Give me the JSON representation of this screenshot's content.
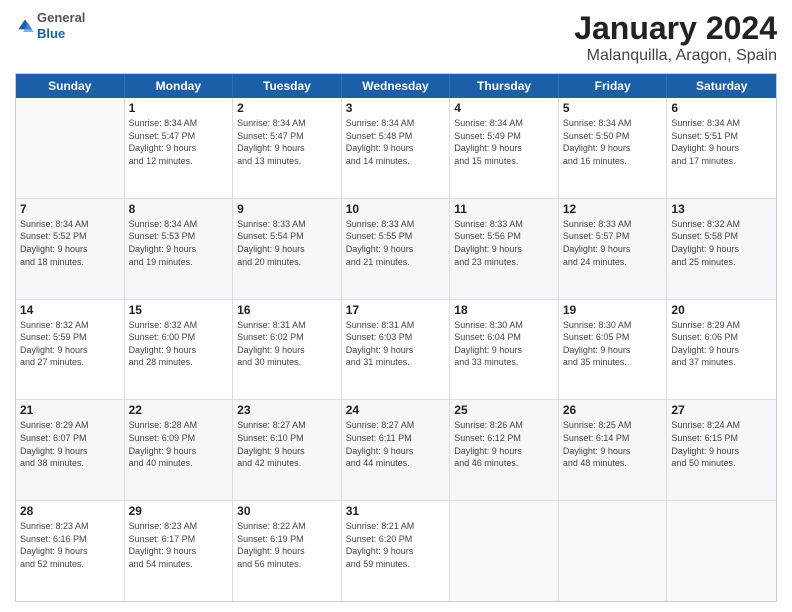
{
  "logo": {
    "general": "General",
    "blue": "Blue"
  },
  "title": "January 2024",
  "subtitle": "Malanquilla, Aragon, Spain",
  "days_header": [
    "Sunday",
    "Monday",
    "Tuesday",
    "Wednesday",
    "Thursday",
    "Friday",
    "Saturday"
  ],
  "weeks": [
    [
      {
        "day": "",
        "info": ""
      },
      {
        "day": "1",
        "info": "Sunrise: 8:34 AM\nSunset: 5:47 PM\nDaylight: 9 hours\nand 12 minutes."
      },
      {
        "day": "2",
        "info": "Sunrise: 8:34 AM\nSunset: 5:47 PM\nDaylight: 9 hours\nand 13 minutes."
      },
      {
        "day": "3",
        "info": "Sunrise: 8:34 AM\nSunset: 5:48 PM\nDaylight: 9 hours\nand 14 minutes."
      },
      {
        "day": "4",
        "info": "Sunrise: 8:34 AM\nSunset: 5:49 PM\nDaylight: 9 hours\nand 15 minutes."
      },
      {
        "day": "5",
        "info": "Sunrise: 8:34 AM\nSunset: 5:50 PM\nDaylight: 9 hours\nand 16 minutes."
      },
      {
        "day": "6",
        "info": "Sunrise: 8:34 AM\nSunset: 5:51 PM\nDaylight: 9 hours\nand 17 minutes."
      }
    ],
    [
      {
        "day": "7",
        "info": "Sunrise: 8:34 AM\nSunset: 5:52 PM\nDaylight: 9 hours\nand 18 minutes."
      },
      {
        "day": "8",
        "info": "Sunrise: 8:34 AM\nSunset: 5:53 PM\nDaylight: 9 hours\nand 19 minutes."
      },
      {
        "day": "9",
        "info": "Sunrise: 8:33 AM\nSunset: 5:54 PM\nDaylight: 9 hours\nand 20 minutes."
      },
      {
        "day": "10",
        "info": "Sunrise: 8:33 AM\nSunset: 5:55 PM\nDaylight: 9 hours\nand 21 minutes."
      },
      {
        "day": "11",
        "info": "Sunrise: 8:33 AM\nSunset: 5:56 PM\nDaylight: 9 hours\nand 23 minutes."
      },
      {
        "day": "12",
        "info": "Sunrise: 8:33 AM\nSunset: 5:57 PM\nDaylight: 9 hours\nand 24 minutes."
      },
      {
        "day": "13",
        "info": "Sunrise: 8:32 AM\nSunset: 5:58 PM\nDaylight: 9 hours\nand 25 minutes."
      }
    ],
    [
      {
        "day": "14",
        "info": "Sunrise: 8:32 AM\nSunset: 5:59 PM\nDaylight: 9 hours\nand 27 minutes."
      },
      {
        "day": "15",
        "info": "Sunrise: 8:32 AM\nSunset: 6:00 PM\nDaylight: 9 hours\nand 28 minutes."
      },
      {
        "day": "16",
        "info": "Sunrise: 8:31 AM\nSunset: 6:02 PM\nDaylight: 9 hours\nand 30 minutes."
      },
      {
        "day": "17",
        "info": "Sunrise: 8:31 AM\nSunset: 6:03 PM\nDaylight: 9 hours\nand 31 minutes."
      },
      {
        "day": "18",
        "info": "Sunrise: 8:30 AM\nSunset: 6:04 PM\nDaylight: 9 hours\nand 33 minutes."
      },
      {
        "day": "19",
        "info": "Sunrise: 8:30 AM\nSunset: 6:05 PM\nDaylight: 9 hours\nand 35 minutes."
      },
      {
        "day": "20",
        "info": "Sunrise: 8:29 AM\nSunset: 6:06 PM\nDaylight: 9 hours\nand 37 minutes."
      }
    ],
    [
      {
        "day": "21",
        "info": "Sunrise: 8:29 AM\nSunset: 6:07 PM\nDaylight: 9 hours\nand 38 minutes."
      },
      {
        "day": "22",
        "info": "Sunrise: 8:28 AM\nSunset: 6:09 PM\nDaylight: 9 hours\nand 40 minutes."
      },
      {
        "day": "23",
        "info": "Sunrise: 8:27 AM\nSunset: 6:10 PM\nDaylight: 9 hours\nand 42 minutes."
      },
      {
        "day": "24",
        "info": "Sunrise: 8:27 AM\nSunset: 6:11 PM\nDaylight: 9 hours\nand 44 minutes."
      },
      {
        "day": "25",
        "info": "Sunrise: 8:26 AM\nSunset: 6:12 PM\nDaylight: 9 hours\nand 46 minutes."
      },
      {
        "day": "26",
        "info": "Sunrise: 8:25 AM\nSunset: 6:14 PM\nDaylight: 9 hours\nand 48 minutes."
      },
      {
        "day": "27",
        "info": "Sunrise: 8:24 AM\nSunset: 6:15 PM\nDaylight: 9 hours\nand 50 minutes."
      }
    ],
    [
      {
        "day": "28",
        "info": "Sunrise: 8:23 AM\nSunset: 6:16 PM\nDaylight: 9 hours\nand 52 minutes."
      },
      {
        "day": "29",
        "info": "Sunrise: 8:23 AM\nSunset: 6:17 PM\nDaylight: 9 hours\nand 54 minutes."
      },
      {
        "day": "30",
        "info": "Sunrise: 8:22 AM\nSunset: 6:19 PM\nDaylight: 9 hours\nand 56 minutes."
      },
      {
        "day": "31",
        "info": "Sunrise: 8:21 AM\nSunset: 6:20 PM\nDaylight: 9 hours\nand 59 minutes."
      },
      {
        "day": "",
        "info": ""
      },
      {
        "day": "",
        "info": ""
      },
      {
        "day": "",
        "info": ""
      }
    ]
  ]
}
